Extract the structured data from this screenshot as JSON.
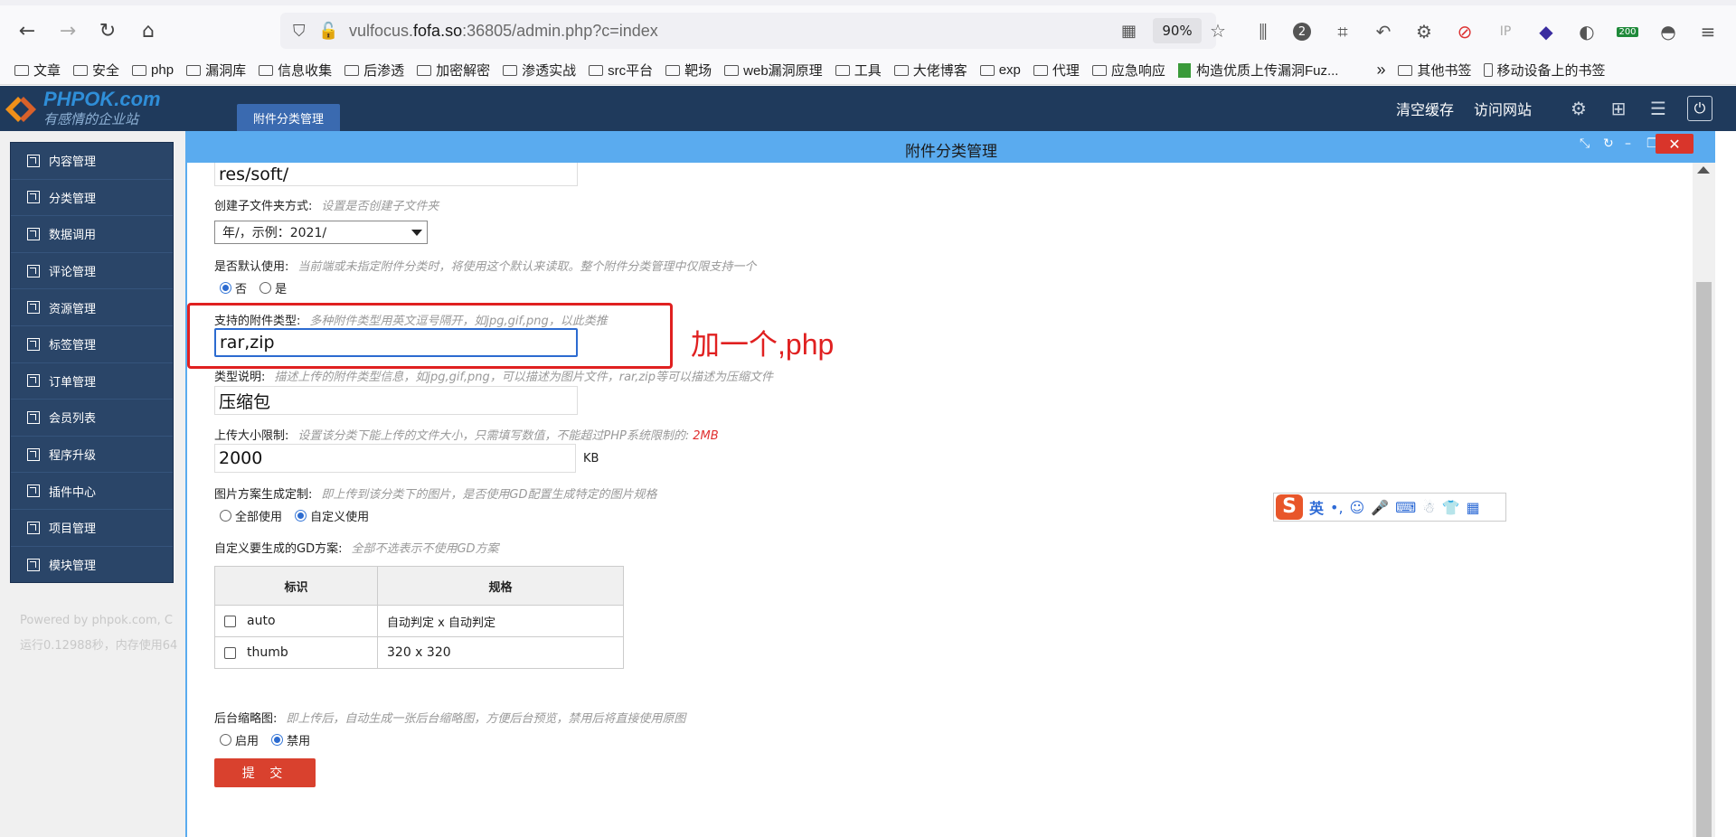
{
  "browser": {
    "url_prefix": "vulfocus.",
    "url_domain": "fofa.so",
    "url_suffix": ":36805/admin.php?c=index",
    "zoom": "90%",
    "tab_badge": "200",
    "ext_ip": "IP",
    "ext_two": "2"
  },
  "bookmarks": [
    "文章",
    "安全",
    "php",
    "漏洞库",
    "信息收集",
    "后渗透",
    "加密解密",
    "渗透实战",
    "src平台",
    "靶场",
    "web漏洞原理",
    "工具",
    "大佬博客",
    "exp",
    "代理",
    "应急响应",
    "构造优质上传漏洞Fuz..."
  ],
  "bookmarks_right": {
    "other": "其他书签",
    "mobile": "移动设备上的书签"
  },
  "header": {
    "logo_main": "PHPOK.com",
    "logo_sub": "有感情的企业站",
    "active_tab": "附件分类管理",
    "clear_cache": "清空缓存",
    "visit_site": "访问网站"
  },
  "sidebar": {
    "items": [
      "内容管理",
      "分类管理",
      "数据调用",
      "评论管理",
      "资源管理",
      "标签管理",
      "订单管理",
      "会员列表",
      "程序升级",
      "插件中心",
      "项目管理",
      "模块管理"
    ],
    "footer_line1": "Powered by phpok.com, C",
    "footer_line2": "运行0.12988秒，内存使用64"
  },
  "panel": {
    "title": "附件分类管理"
  },
  "form": {
    "folder_value": "res/soft/",
    "subfolder_label": "创建子文件夹方式:",
    "subfolder_hint": "设置是否创建子文件夹",
    "subfolder_select": "年/，示例：2021/",
    "default_label": "是否默认使用:",
    "default_hint": "当前端或未指定附件分类时，将使用这个默认来读取。整个附件分类管理中仅限支持一个",
    "default_no": "否",
    "default_yes": "是",
    "types_label": "支持的附件类型:",
    "types_hint": "多种附件类型用英文逗号隔开，如jpg,gif,png，以此类推",
    "types_value": "rar,zip",
    "desc_label": "类型说明:",
    "desc_hint": "描述上传的附件类型信息，如jpg,gif,png，可以描述为图片文件，rar,zip等可以描述为压缩文件",
    "desc_value": "压缩包",
    "size_label": "上传大小限制:",
    "size_hint": "设置该分类下能上传的文件大小，只需填写数值，不能超过PHP系统限制的:",
    "size_limit": "2MB",
    "size_value": "2000",
    "size_unit": "KB",
    "img_label": "图片方案生成定制:",
    "img_hint": "即上传到该分类下的图片，是否使用GD配置生成特定的图片规格",
    "img_all": "全部使用",
    "img_custom": "自定义使用",
    "gd_label": "自定义要生成的GD方案:",
    "gd_hint": "全部不选表示不使用GD方案",
    "gd_table": {
      "headers": [
        "标识",
        "规格"
      ],
      "rows": [
        [
          "auto",
          "自动判定 x 自动判定"
        ],
        [
          "thumb",
          "320 x 320"
        ]
      ]
    },
    "thumb_label": "后台缩略图:",
    "thumb_hint": "即上传后，自动生成一张后台缩略图，方便后台预览，禁用后将直接使用原图",
    "thumb_on": "启用",
    "thumb_off": "禁用",
    "submit": "提 交"
  },
  "annotation": "加一个,php",
  "ime": {
    "lang": "英",
    "punct": "•,"
  }
}
